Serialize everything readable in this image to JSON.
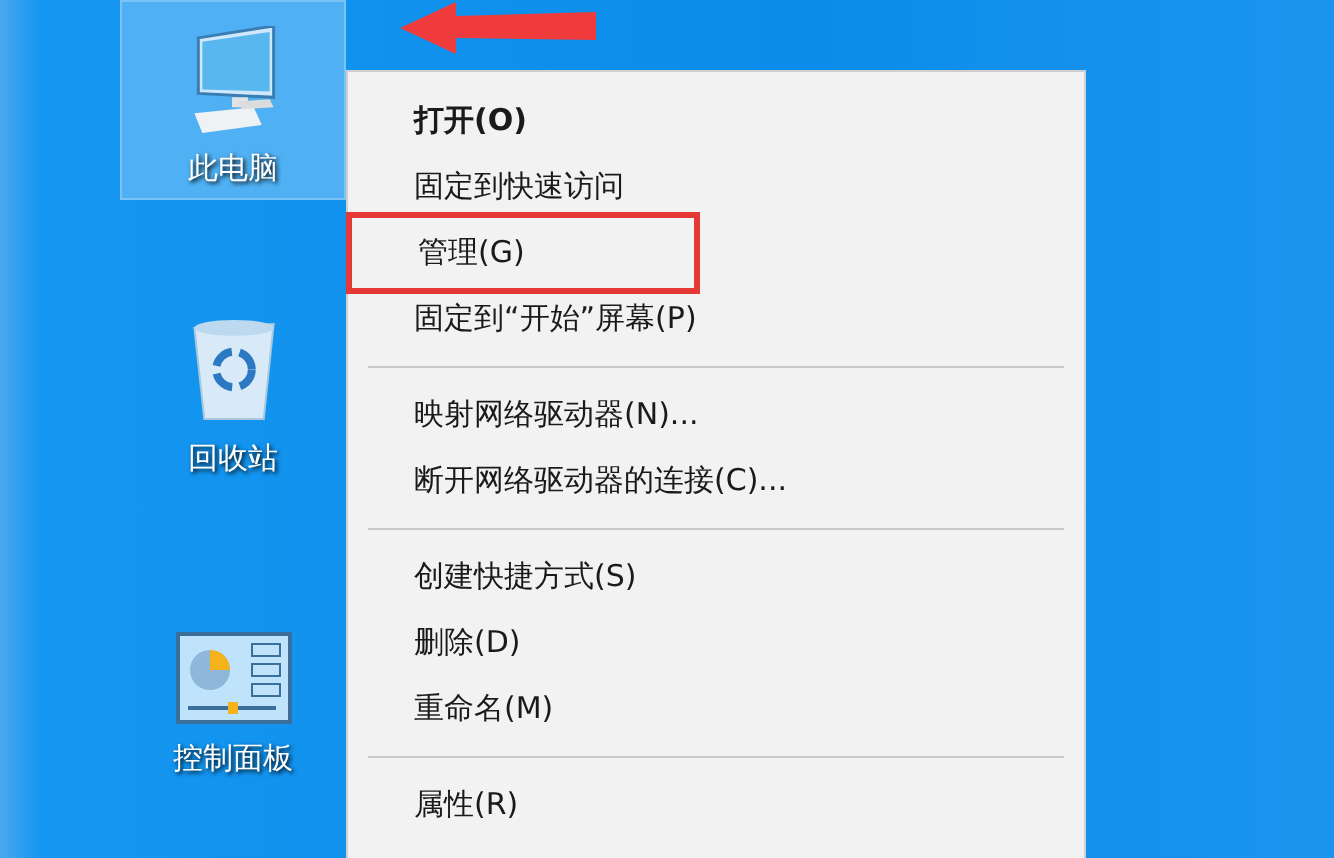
{
  "desktop_icons": [
    {
      "label": "此电脑",
      "kind": "computer",
      "selected": true
    },
    {
      "label": "回收站",
      "kind": "recycle",
      "selected": false
    },
    {
      "label": "控制面板",
      "kind": "control",
      "selected": false
    }
  ],
  "context_menu": {
    "items": [
      {
        "kind": "item",
        "label": "打开(O)",
        "bold": true,
        "annotated": false
      },
      {
        "kind": "item",
        "label": "固定到快速访问",
        "bold": false,
        "annotated": false
      },
      {
        "kind": "item",
        "label": "管理(G)",
        "bold": false,
        "annotated": true
      },
      {
        "kind": "item",
        "label": "固定到“开始”屏幕(P)",
        "bold": false,
        "annotated": false
      },
      {
        "kind": "separator"
      },
      {
        "kind": "item",
        "label": "映射网络驱动器(N)...",
        "bold": false,
        "annotated": false
      },
      {
        "kind": "item",
        "label": "断开网络驱动器的连接(C)...",
        "bold": false,
        "annotated": false
      },
      {
        "kind": "separator"
      },
      {
        "kind": "item",
        "label": "创建快捷方式(S)",
        "bold": false,
        "annotated": false
      },
      {
        "kind": "item",
        "label": "删除(D)",
        "bold": false,
        "annotated": false
      },
      {
        "kind": "item",
        "label": "重命名(M)",
        "bold": false,
        "annotated": false
      },
      {
        "kind": "separator"
      },
      {
        "kind": "item",
        "label": "属性(R)",
        "bold": false,
        "annotated": false
      }
    ]
  }
}
